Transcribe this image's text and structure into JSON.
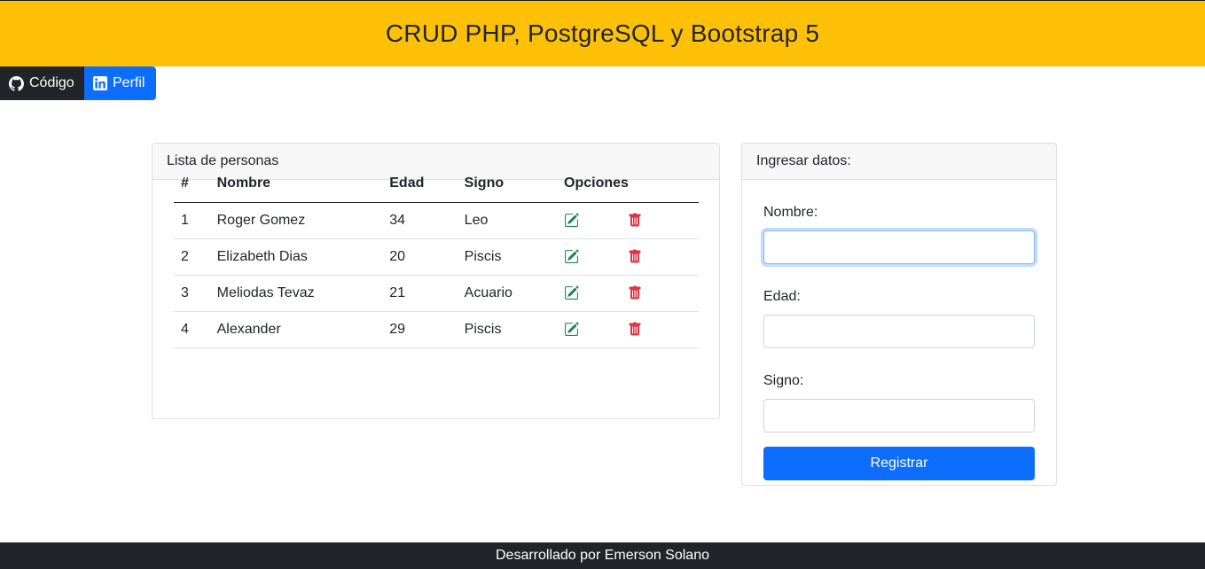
{
  "header": {
    "title": "CRUD PHP, PostgreSQL y Bootstrap 5"
  },
  "links": [
    {
      "label": "Código",
      "icon": "github-icon"
    },
    {
      "label": "Perfil",
      "icon": "linkedin-icon"
    }
  ],
  "list": {
    "title": "Lista de personas",
    "columns": [
      "#",
      "Nombre",
      "Edad",
      "Signo",
      "Opciones"
    ],
    "rows": [
      {
        "id": "1",
        "name": "Roger Gomez",
        "age": "34",
        "sign": "Leo"
      },
      {
        "id": "2",
        "name": "Elizabeth Dias",
        "age": "20",
        "sign": "Piscis"
      },
      {
        "id": "3",
        "name": "Meliodas Tevaz",
        "age": "21",
        "sign": "Acuario"
      },
      {
        "id": "4",
        "name": "Alexander",
        "age": "29",
        "sign": "Piscis"
      }
    ],
    "edit_icon": "edit-icon",
    "delete_icon": "trash-icon"
  },
  "form": {
    "title": "Ingresar datos:",
    "name_label": "Nombre:",
    "name_value": "",
    "age_label": "Edad:",
    "age_value": "",
    "sign_label": "Signo:",
    "sign_value": "",
    "submit_label": "Registrar"
  },
  "footer": {
    "text": "Desarrollado por Emerson Solano"
  },
  "colors": {
    "header_bg": "#ffc107",
    "primary": "#0d6efd",
    "dark": "#212529",
    "edit": "#198754",
    "delete": "#dc3545"
  }
}
